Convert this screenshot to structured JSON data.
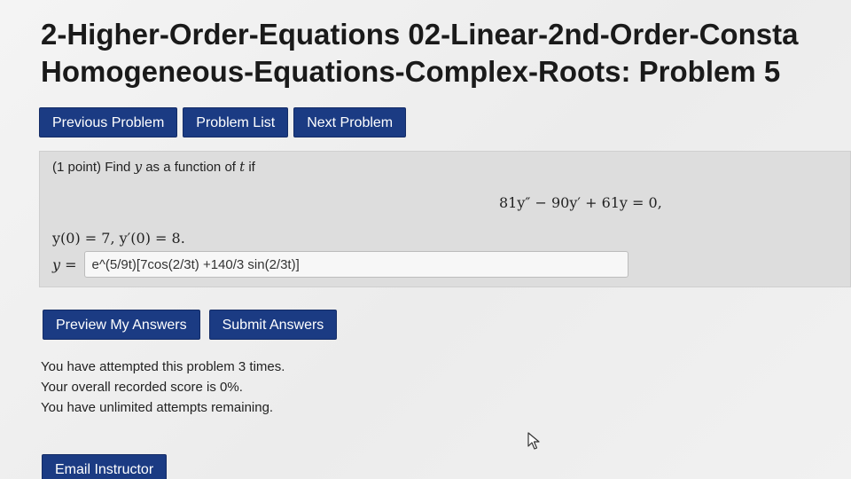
{
  "header": {
    "title_line1": "2-Higher-Order-Equations 02-Linear-2nd-Order-Consta",
    "title_line2": "Homogeneous-Equations-Complex-Roots: Problem 5"
  },
  "nav": {
    "previous_label": "Previous Problem",
    "list_label": "Problem List",
    "next_label": "Next Problem"
  },
  "problem": {
    "points": "(1 point)",
    "prompt_find": "Find",
    "var_y": "y",
    "prompt_mid": "as a function of",
    "var_t": "t",
    "prompt_end": "if",
    "equation": "81y″ − 90y′ + 61y = 0,",
    "initial_conditions": "y(0) = 7,   y′(0) = 8.",
    "answer_label": "y =",
    "answer_value": "e^(5/9t)[7cos(2/3t) +140/3 sin(2/3t)]"
  },
  "actions": {
    "preview_label": "Preview My Answers",
    "submit_label": "Submit Answers"
  },
  "status": {
    "attempts": "You have attempted this problem 3 times.",
    "score": "Your overall recorded score is 0%.",
    "remaining": "You have unlimited attempts remaining."
  },
  "footer": {
    "email_label": "Email Instructor"
  },
  "colors": {
    "button_bg": "#1b3b83",
    "problem_box_bg": "#dddddd"
  },
  "icons": {
    "cursor": "mouse-pointer-icon"
  }
}
